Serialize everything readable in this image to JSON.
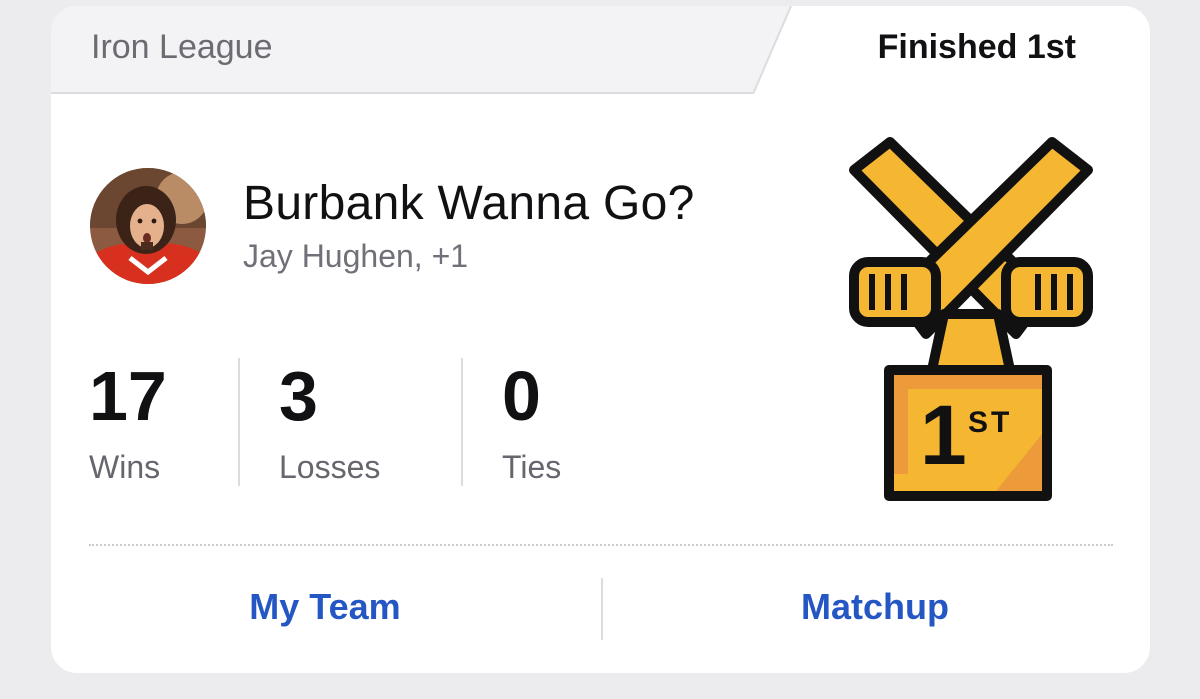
{
  "header": {
    "league_name": "Iron League",
    "finish_label": "Finished 1st"
  },
  "team": {
    "name": "Burbank Wanna Go?",
    "owners": "Jay Hughen, +1"
  },
  "record": [
    {
      "value": "17",
      "label": "Wins"
    },
    {
      "value": "3",
      "label": "Losses"
    },
    {
      "value": "0",
      "label": "Ties"
    }
  ],
  "trophy": {
    "place_number": "1",
    "place_suffix": "ST",
    "colors": {
      "gold": "#f5b731",
      "outline": "#111111",
      "accent": "#ec9a3a"
    }
  },
  "actions": {
    "my_team_label": "My Team",
    "matchup_label": "Matchup"
  },
  "colors": {
    "link": "#2456c4",
    "header_bg": "#f3f3f5"
  }
}
